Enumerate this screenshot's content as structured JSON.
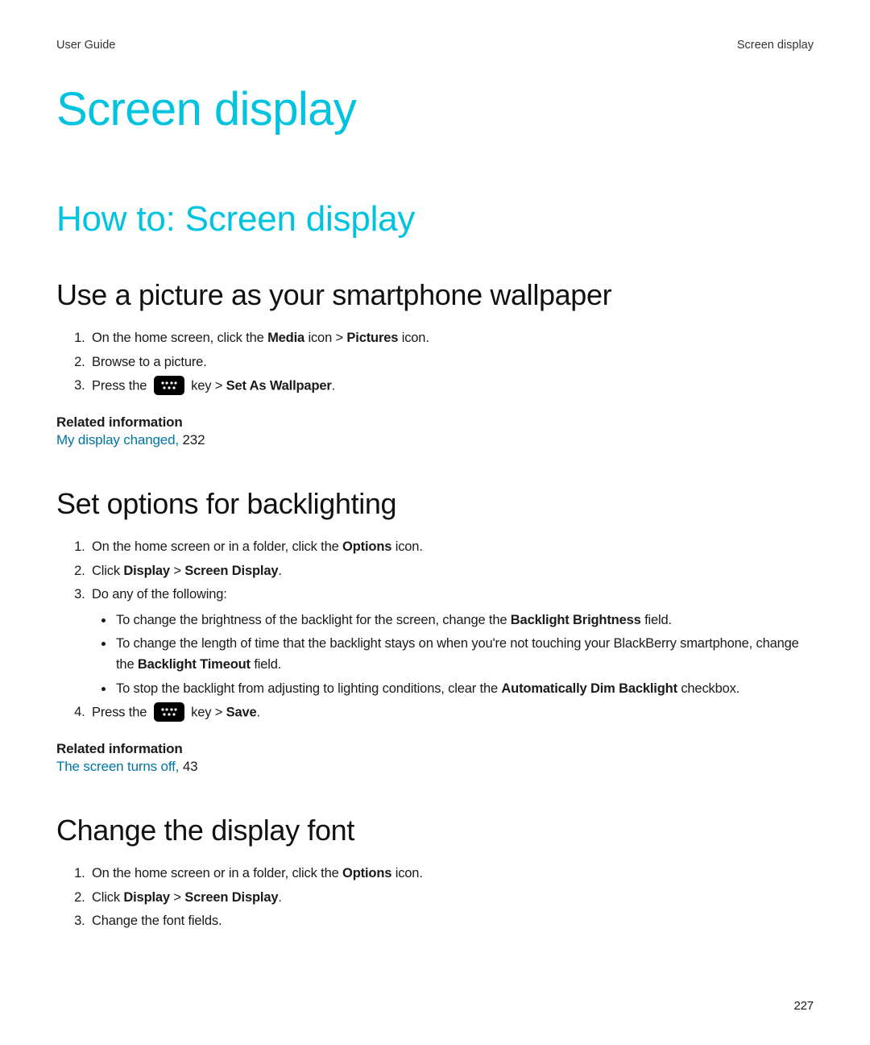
{
  "header": {
    "left": "User Guide",
    "right": "Screen display"
  },
  "title": "Screen display",
  "section": "How to: Screen display",
  "topic1": {
    "heading": "Use a picture as your smartphone wallpaper",
    "step1_a": "On the home screen, click the ",
    "step1_b": "Media",
    "step1_c": " icon > ",
    "step1_d": "Pictures",
    "step1_e": " icon.",
    "step2": "Browse to a picture.",
    "step3_a": "Press the ",
    "step3_b": " key > ",
    "step3_c": "Set As Wallpaper",
    "step3_d": ".",
    "related_heading": "Related information",
    "related_link": "My display changed,",
    "related_page": " 232"
  },
  "topic2": {
    "heading": "Set options for backlighting",
    "step1_a": "On the home screen or in a folder, click the ",
    "step1_b": "Options",
    "step1_c": " icon.",
    "step2_a": "Click ",
    "step2_b": "Display",
    "step2_c": " > ",
    "step2_d": "Screen Display",
    "step2_e": ".",
    "step3": "Do any of the following:",
    "b1_a": "To change the brightness of the backlight for the screen, change the ",
    "b1_b": "Backlight Brightness",
    "b1_c": " field.",
    "b2_a": "To change the length of time that the backlight stays on when you're not touching your BlackBerry smartphone, change the ",
    "b2_b": "Backlight Timeout",
    "b2_c": " field.",
    "b3_a": "To stop the backlight from adjusting to lighting conditions, clear the ",
    "b3_b": "Automatically Dim Backlight",
    "b3_c": " checkbox.",
    "step4_a": "Press the ",
    "step4_b": " key > ",
    "step4_c": "Save",
    "step4_d": ".",
    "related_heading": "Related information",
    "related_link": "The screen turns off,",
    "related_page": " 43"
  },
  "topic3": {
    "heading": "Change the display font",
    "step1_a": "On the home screen or in a folder, click the ",
    "step1_b": "Options",
    "step1_c": " icon.",
    "step2_a": "Click ",
    "step2_b": "Display",
    "step2_c": " > ",
    "step2_d": "Screen Display",
    "step2_e": ".",
    "step3": "Change the font fields."
  },
  "page_number": "227"
}
